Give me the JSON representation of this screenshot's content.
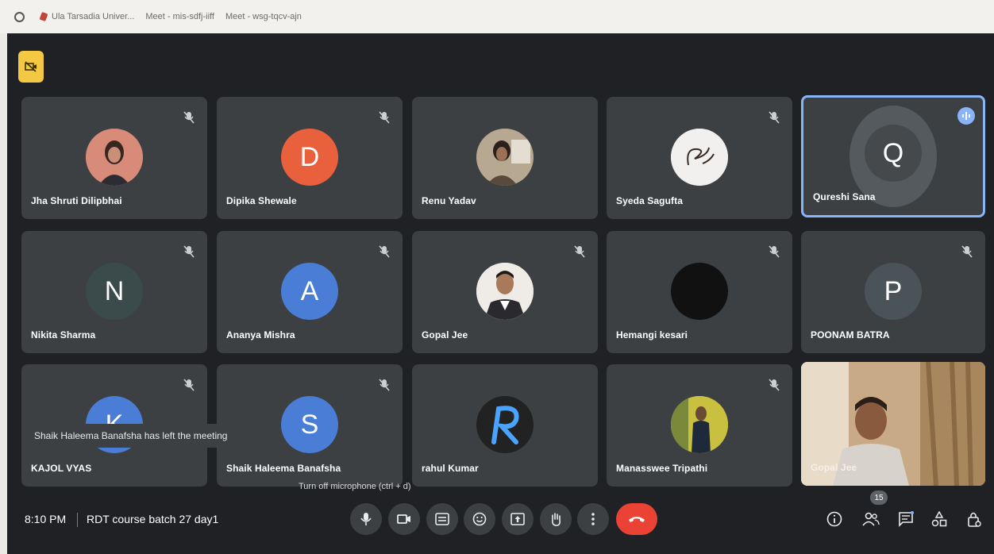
{
  "bookmarks": [
    {
      "label": ""
    },
    {
      "label": "Ula Tarsadia Univer..."
    },
    {
      "label": "Meet - mis-sdfj-iiff"
    },
    {
      "label": "Meet - wsg-tqcv-ajn"
    }
  ],
  "participants": [
    {
      "name": "Jha Shruti Dilipbhai",
      "initial": "",
      "color": "#d98b7a",
      "muted": true
    },
    {
      "name": "Dipika Shewale",
      "initial": "D",
      "color": "#e8603c",
      "muted": true
    },
    {
      "name": "Renu Yadav",
      "initial": "",
      "color": "#8a7a6a",
      "muted": false
    },
    {
      "name": "Syeda Sagufta",
      "initial": "",
      "color": "#f2f0ee",
      "muted": true
    },
    {
      "name": "Qureshi Sana",
      "initial": "Q",
      "color": "#5b5d60",
      "muted": false,
      "speaking": true
    },
    {
      "name": "Nikita Sharma",
      "initial": "N",
      "color": "#3b4a4a",
      "muted": true
    },
    {
      "name": "Ananya Mishra",
      "initial": "A",
      "color": "#4a7dd6",
      "muted": true
    },
    {
      "name": "Gopal Jee",
      "initial": "",
      "color": "#e8e4e0",
      "muted": true
    },
    {
      "name": "Hemangi kesari",
      "initial": "",
      "color": "#111111",
      "muted": true
    },
    {
      "name": "POONAM BATRA",
      "initial": "P",
      "color": "#4a5458",
      "muted": true
    },
    {
      "name": "KAJOL VYAS",
      "initial": "K",
      "color": "#4a7dd6",
      "muted": true
    },
    {
      "name": "Shaik Haleema Banafsha",
      "initial": "S",
      "color": "#4a7dd6",
      "muted": true
    },
    {
      "name": "rahul Kumar",
      "initial": "",
      "color": "#2a2a2a",
      "muted": false
    },
    {
      "name": "Manasswee Tripathi",
      "initial": "",
      "color": "#c8b830",
      "muted": true
    },
    {
      "name": "Gopal Jee",
      "initial": "",
      "color": "#b89a78",
      "muted": false,
      "video": true
    }
  ],
  "toast": "Shaik Haleema Banafsha has left the meeting",
  "tooltip": "Turn off microphone (ctrl + d)",
  "footer": {
    "time": "8:10 PM",
    "meeting_name": "RDT course batch 27 day1",
    "participant_count": "15"
  },
  "controls": [
    "mic-icon",
    "camera-icon",
    "captions-icon",
    "emoji-icon",
    "present-icon",
    "raise-hand-icon",
    "more-options-icon",
    "end-call-icon"
  ],
  "side_controls": [
    "info-icon",
    "people-icon",
    "chat-icon",
    "activities-icon",
    "host-controls-icon"
  ],
  "colors": {
    "meet_bg": "#202124",
    "tile_bg": "#3c4043",
    "end_call": "#ea4335",
    "active_border": "#8ab4f8"
  }
}
